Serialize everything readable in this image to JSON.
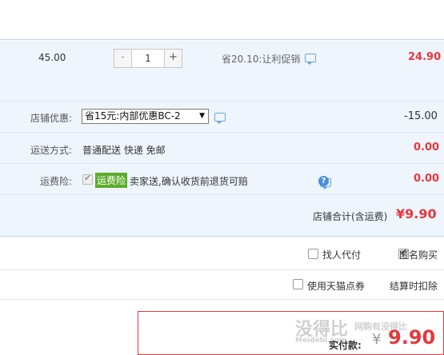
{
  "item": {
    "price": "45.00",
    "qty_minus": "-",
    "qty_value": "1",
    "qty_plus": "+",
    "promo_text": "省20.10:让利促销",
    "subtotal": "24.90"
  },
  "shop_discount": {
    "label": "店铺优惠:",
    "selected_option": "省15元:内部优惠BC-2",
    "amount": "-15.00"
  },
  "shipping": {
    "label": "运送方式:",
    "options_text": "普通配送 快递 免邮",
    "amount": "0.00"
  },
  "insurance": {
    "label": "运费险:",
    "tag": "运费险",
    "text": "卖家送,确认收货前退货可赔",
    "amount": "0.00"
  },
  "shop_total": {
    "label": "店铺合计(含运费)",
    "value": "¥9.90"
  },
  "options": {
    "pay_for_me": "找人代付",
    "anonymous": "匿名购买",
    "tmall_points": "使用天猫点券",
    "deduct_at_settle": "结算时扣除"
  },
  "payment": {
    "label": "实付款:",
    "currency": "¥",
    "amount": "9.90"
  },
  "watermark": {
    "logo": "没得比",
    "domain": "Meidebi.com",
    "slogan": "网购有没得比"
  },
  "colors": {
    "accent_red": "#e4393c",
    "panel_bg": "#eef5fc",
    "tag_green": "#5cae2c",
    "icon_blue": "#4a90d9"
  }
}
